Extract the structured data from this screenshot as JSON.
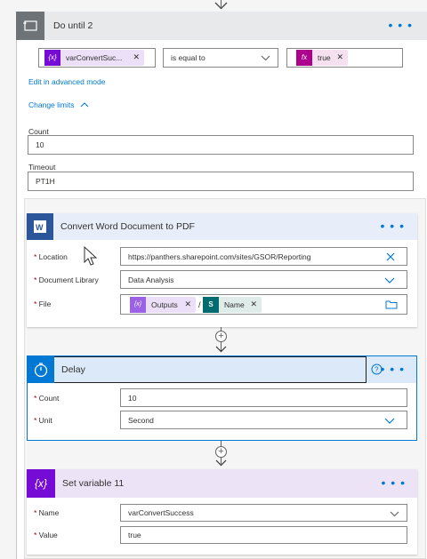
{
  "do_until": {
    "title": "Do until 2",
    "condition": {
      "left_token": "varConvertSuc...",
      "left_token_icon": "{x}",
      "operator": "is equal to",
      "right_token": "true",
      "right_token_icon": "fx"
    },
    "edit_advanced": "Edit in advanced mode",
    "change_limits": "Change limits",
    "count_label": "Count",
    "count_value": "10",
    "timeout_label": "Timeout",
    "timeout_value": "PT1H"
  },
  "convert": {
    "title": "Convert Word Document to PDF",
    "location_label": "Location",
    "location_value": "https://panthers.sharepoint.com/sites/GSOR/Reporting",
    "library_label": "Document Library",
    "library_value": "Data Analysis",
    "file_label": "File",
    "file_token1": "Outputs",
    "file_token1_icon": "{x}",
    "file_sep": "/",
    "file_token2": "Name",
    "file_token2_icon": "S"
  },
  "delay": {
    "title": "Delay",
    "count_label": "Count",
    "count_value": "10",
    "unit_label": "Unit",
    "unit_value": "Second"
  },
  "set_variable": {
    "title": "Set variable 11",
    "name_label": "Name",
    "name_value": "varConvertSuccess",
    "value_label": "Value",
    "value_value": "true"
  },
  "menu_glyph": "• • •",
  "colors": {
    "do_until_header": "#e8e9eb",
    "convert_header": "#e8eef9",
    "delay_header": "#dce9f8",
    "delay_accent": "#0078d4",
    "variable_header": "#ece4f6",
    "variable_icon": "#770bd6",
    "word_blue": "#2b579a",
    "link": "#0078d4"
  }
}
